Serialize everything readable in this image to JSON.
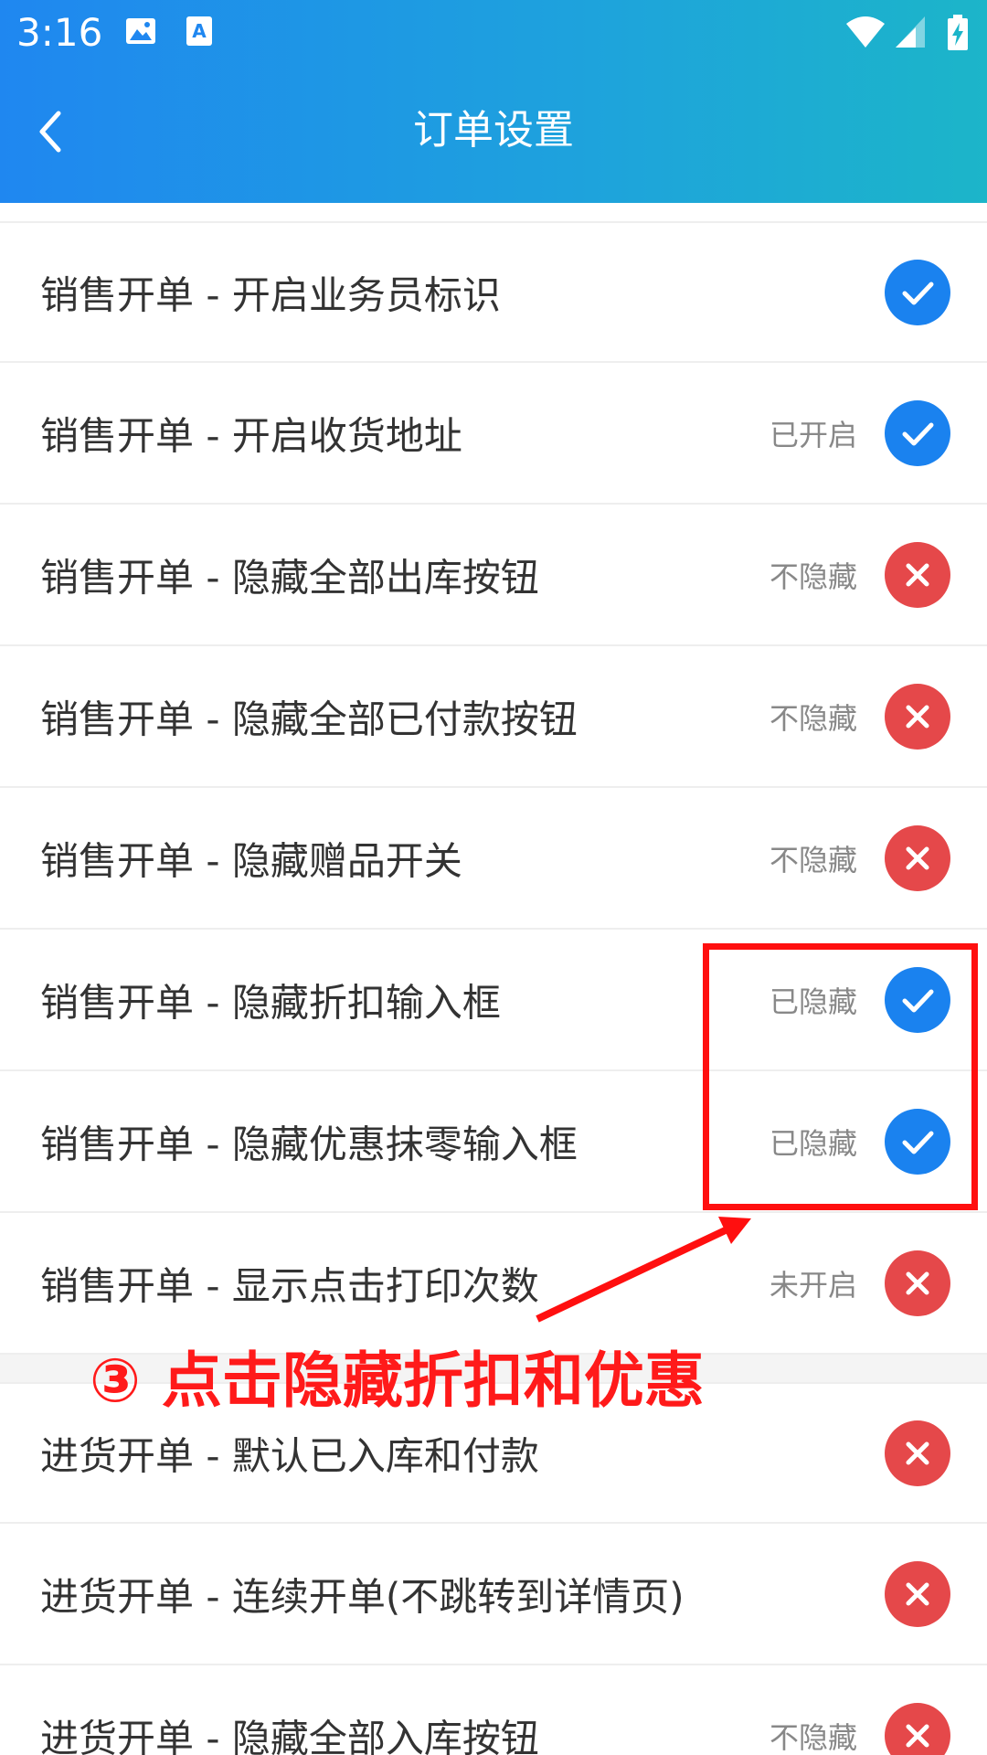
{
  "status_bar": {
    "time": "3:16",
    "icons": [
      "image-icon",
      "font-download-icon",
      "wifi-icon",
      "signal-icon",
      "battery-charging-icon"
    ]
  },
  "header": {
    "title": "订单设置",
    "back_icon": "chevron-left-icon"
  },
  "colors": {
    "header_gradient": [
      "#1f87f0",
      "#1cb5c9"
    ],
    "toggle_on": "#1a82ef",
    "toggle_off": "#e5484a",
    "annotation": "#ff1a1a"
  },
  "settings": [
    {
      "label": "销售开单 - 开启业务员标识",
      "status": "",
      "enabled": true
    },
    {
      "label": "销售开单 - 开启收货地址",
      "status": "已开启",
      "enabled": true
    },
    {
      "label": "销售开单 - 隐藏全部出库按钮",
      "status": "不隐藏",
      "enabled": false
    },
    {
      "label": "销售开单 - 隐藏全部已付款按钮",
      "status": "不隐藏",
      "enabled": false
    },
    {
      "label": "销售开单 - 隐藏赠品开关",
      "status": "不隐藏",
      "enabled": false
    },
    {
      "label": "销售开单 - 隐藏折扣输入框",
      "status": "已隐藏",
      "enabled": true
    },
    {
      "label": "销售开单 - 隐藏优惠抹零输入框",
      "status": "已隐藏",
      "enabled": true
    },
    {
      "label": "销售开单 - 显示点击打印次数",
      "status": "未开启",
      "enabled": false
    }
  ],
  "purchase_settings": [
    {
      "label": "进货开单 - 默认已入库和付款",
      "status": "",
      "enabled": false
    },
    {
      "label": "进货开单 - 连续开单(不跳转到详情页)",
      "status": "",
      "enabled": false
    },
    {
      "label": "进货开单 - 隐藏全部入库按钮",
      "status": "不隐藏",
      "enabled": false
    }
  ],
  "annotation": {
    "text": "③ 点击隐藏折扣和优惠"
  }
}
